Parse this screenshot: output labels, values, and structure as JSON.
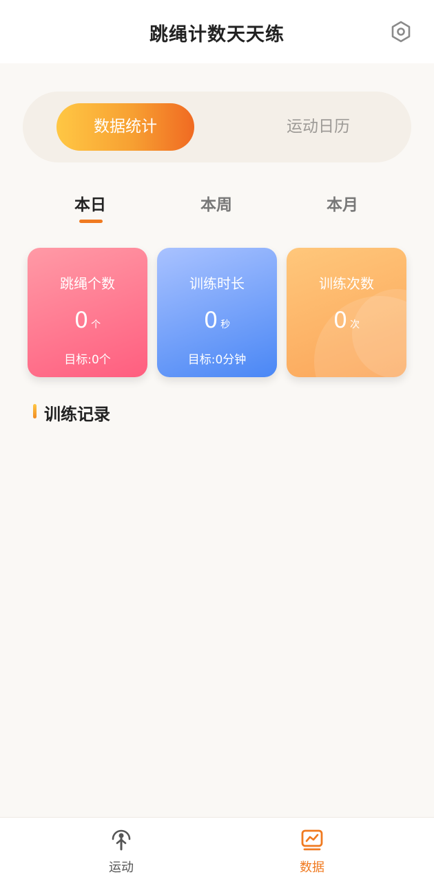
{
  "header": {
    "title": "跳绳计数天天练",
    "settings_icon": "settings-icon"
  },
  "segment": {
    "active_label": "数据统计",
    "inactive_label": "运动日历"
  },
  "tabs": [
    {
      "label": "本日",
      "active": true
    },
    {
      "label": "本周",
      "active": false
    },
    {
      "label": "本月",
      "active": false
    }
  ],
  "cards": [
    {
      "title": "跳绳个数",
      "value": "0",
      "unit": "个",
      "goal": "目标:0个",
      "color": "#ff6f8a"
    },
    {
      "title": "训练时长",
      "value": "0",
      "unit": "秒",
      "goal": "目标:0分钟",
      "color": "#5b8ff7"
    },
    {
      "title": "训练次数",
      "value": "0",
      "unit": "次",
      "goal": "",
      "color": "#fbaa5e"
    }
  ],
  "section": {
    "title": "训练记录"
  },
  "bottom_nav": [
    {
      "label": "运动",
      "icon": "jump-rope-icon",
      "active": false,
      "color": "#555555"
    },
    {
      "label": "数据",
      "icon": "chart-icon",
      "active": true,
      "color": "#f07a20"
    }
  ],
  "colors": {
    "accent": "#f07a20",
    "background": "#faf8f5"
  }
}
